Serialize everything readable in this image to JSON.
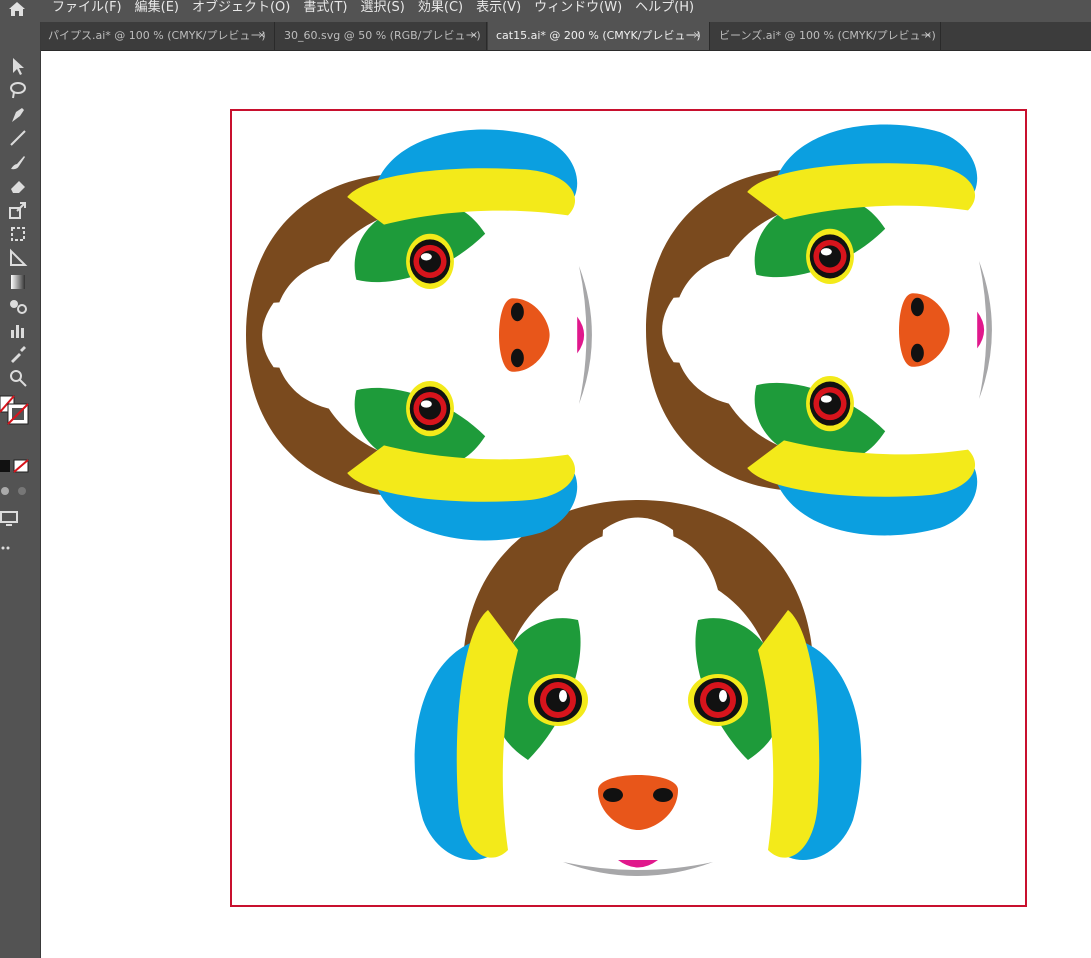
{
  "menubar": {
    "items": [
      "ファイル(F)",
      "編集(E)",
      "オブジェクト(O)",
      "書式(T)",
      "選択(S)",
      "効果(C)",
      "表示(V)",
      "ウィンドウ(W)",
      "ヘルプ(H)"
    ]
  },
  "tabs": [
    {
      "label": "パイプス.ai* @ 100 % (CMYK/プレビュー)",
      "close": "×",
      "active": false
    },
    {
      "label": "30_60.svg @ 50 % (RGB/プレビュー)",
      "close": "×",
      "active": false
    },
    {
      "label": "cat15.ai* @ 200 % (CMYK/プレビュー)",
      "close": "×",
      "active": true
    },
    {
      "label": "ビーンズ.ai* @ 100 % (CMYK/プレビュー)",
      "close": "×",
      "active": false
    }
  ],
  "colors": {
    "artboard_border": "#c8102e",
    "ear_blue": "#0b9fe0",
    "ear_yellow": "#f3ea1a",
    "fur_brown": "#7a4a1e",
    "eye_green": "#1e9b3a",
    "eye_red": "#d7141c",
    "nose_orange": "#e8561a",
    "tongue_pink": "#e0188c",
    "jaw_gray": "#a7a7a9"
  }
}
